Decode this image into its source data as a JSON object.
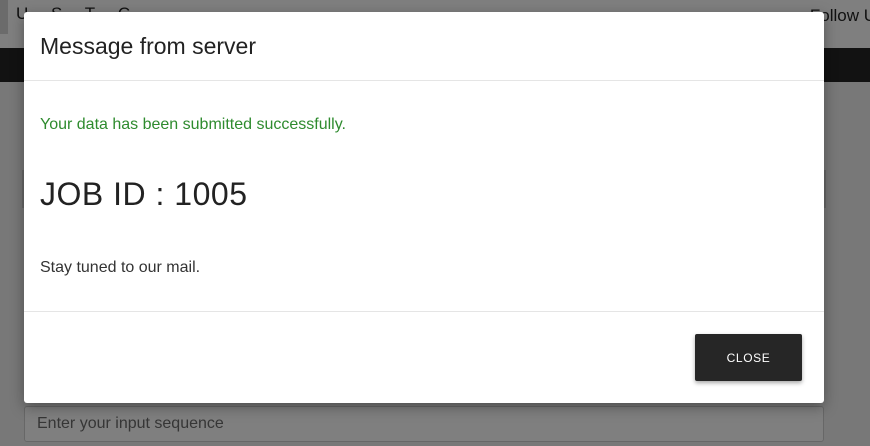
{
  "background": {
    "nav_links": [
      "U",
      "S",
      "T",
      "C"
    ],
    "follow_label": "Follow U",
    "input_placeholder": "Enter your input sequence"
  },
  "modal": {
    "title": "Message from server",
    "success_message": "Your data has been submitted successfully.",
    "job_id_text": "JOB ID : 1005",
    "info_text": "Stay tuned to our mail.",
    "close_label": "CLOSE"
  },
  "colors": {
    "success": "#2e8b2e",
    "button_bg": "#262626",
    "header_bar": "#252525"
  }
}
